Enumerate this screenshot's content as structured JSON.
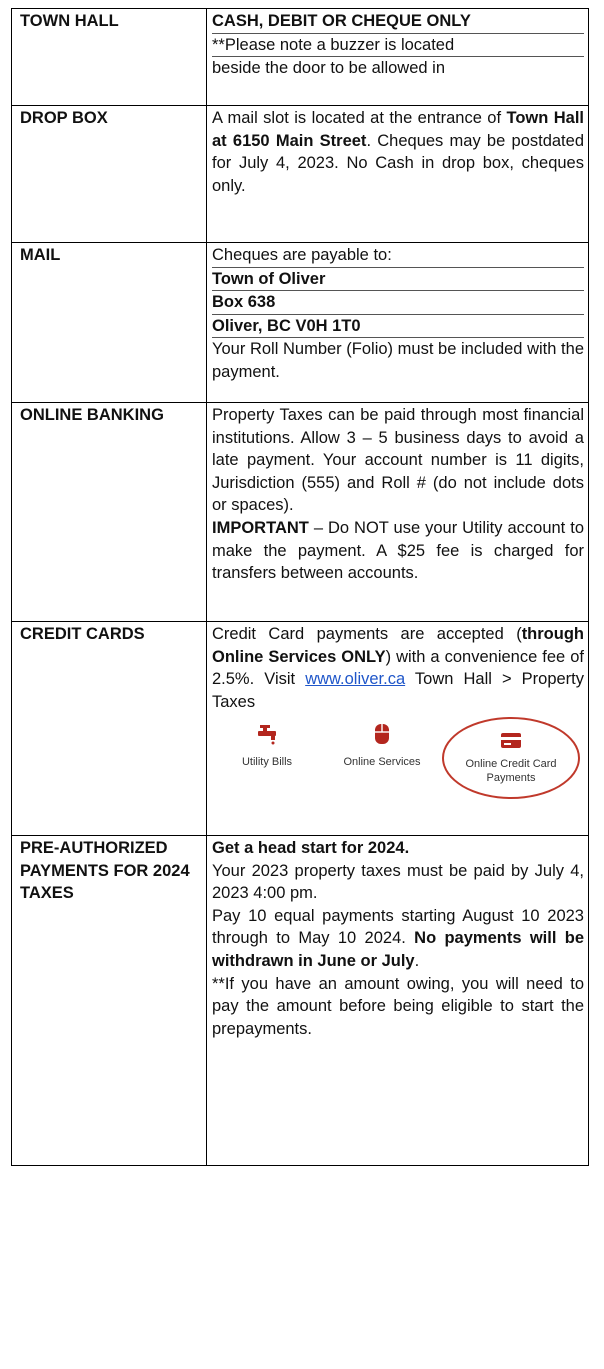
{
  "rows": [
    {
      "label": "TOWN HALL",
      "line1": "CASH, DEBIT OR CHEQUE ONLY",
      "line2": "**Please note a buzzer is located",
      "line3": "beside the door to be allowed in"
    },
    {
      "label": "DROP BOX",
      "text1": "A mail slot is located at the entrance of ",
      "bold1": "Town Hall at 6150 Main Street",
      "text2": ". Cheques may be postdated for July 4, 2023. No Cash in drop box, cheques only."
    },
    {
      "label": "MAIL",
      "line1": "Cheques are payable to:",
      "line2": "Town of Oliver",
      "line3": "Box 638",
      "line4": "Oliver, BC  V0H 1T0",
      "line5": "Your Roll Number (Folio) must be included with the payment."
    },
    {
      "label": "ONLINE BANKING",
      "text1": "Property Taxes can be paid through most financial institutions. Allow 3 – 5 business days to avoid a late payment. Your account number is 11 digits, Jurisdiction (555) and Roll # (do not include dots or spaces).",
      "bold1": "IMPORTANT",
      "text2": " – Do NOT use your Utility account to make the payment. A $25 fee is charged for transfers between accounts."
    },
    {
      "label": "CREDIT CARDS",
      "text1": "Credit Card payments are accepted (",
      "bold1": "through Online Services ONLY",
      "text2": ") with a convenience fee of 2.5%. Visit ",
      "link": "www.oliver.ca",
      "text3": " Town Hall > Property Taxes",
      "icons": [
        {
          "name": "faucet-icon",
          "label": "Utility Bills"
        },
        {
          "name": "mouse-icon",
          "label": "Online Services"
        },
        {
          "name": "credit-card-icon",
          "label": "Online Credit Card Payments"
        }
      ],
      "accent_color": "#c0392b"
    },
    {
      "label": "PRE-AUTHORIZED PAYMENTS FOR 2024 TAXES",
      "bold1": "Get a head start for 2024.",
      "line2": "Your 2023 property taxes must be paid by July 4, 2023 4:00 pm.",
      "text3": "Pay 10 equal payments starting August 10 2023 through to May 10 2024. ",
      "bold3": "No payments will be withdrawn in June or July",
      "text3b": ".",
      "line4": "**If you have an amount owing, you will need to pay the amount before being eligible to start the prepayments."
    }
  ]
}
